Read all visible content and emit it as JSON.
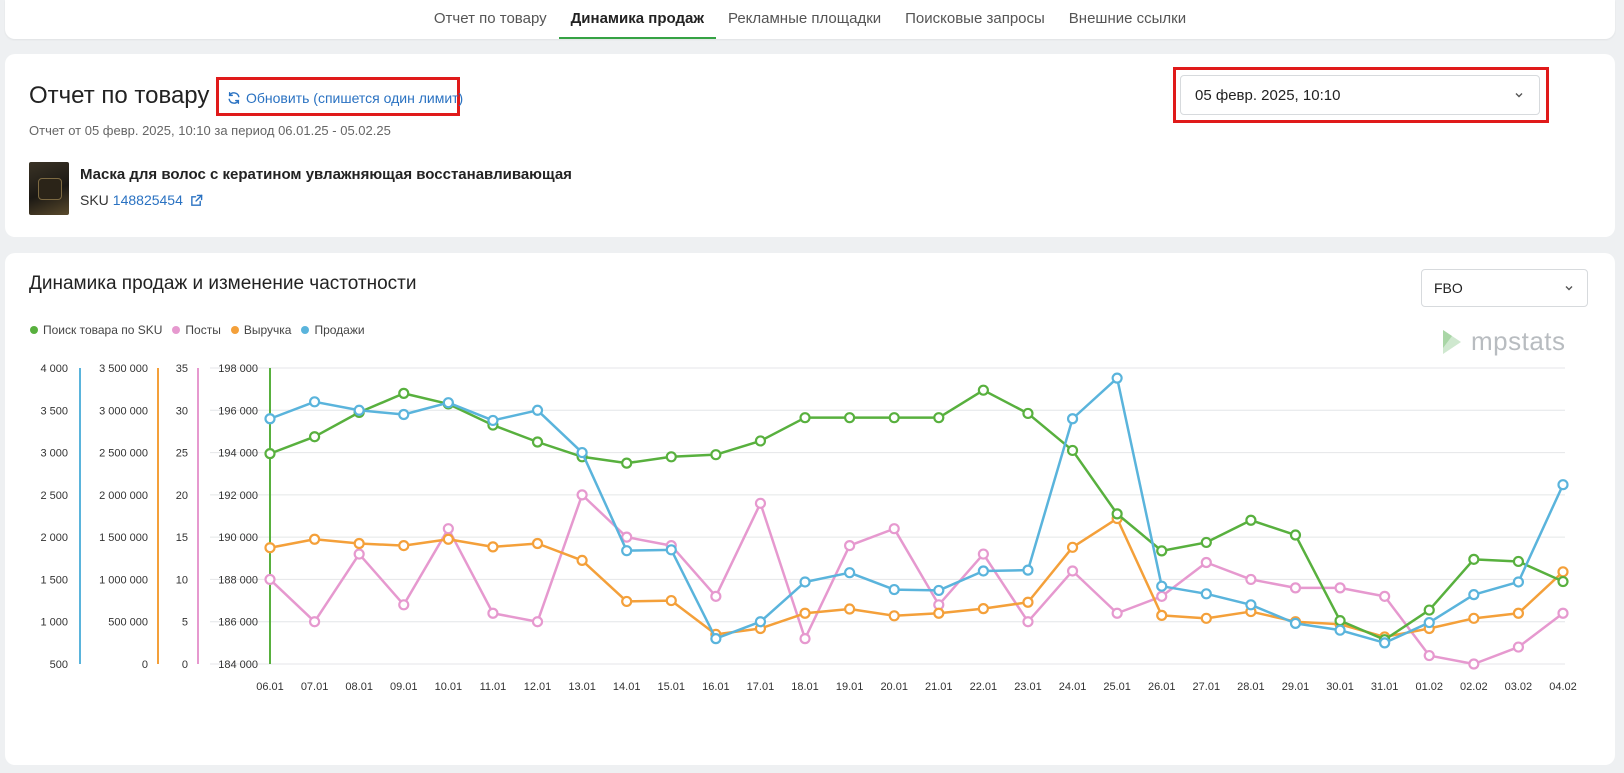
{
  "tabs": [
    {
      "label": "Отчет по товару",
      "active": false
    },
    {
      "label": "Динамика продаж",
      "active": true
    },
    {
      "label": "Рекламные площадки",
      "active": false
    },
    {
      "label": "Поисковые запросы",
      "active": false
    },
    {
      "label": "Внешние ссылки",
      "active": false
    }
  ],
  "report": {
    "title": "Отчет по товару",
    "refresh_label": "Обновить (спишется один лимит)",
    "subtitle": "Отчет от 05 февр. 2025, 10:10 за период 06.01.25 - 05.02.25",
    "product_name": "Маска для волос с кератином увлажняющая восстанавливающая",
    "sku_label": "SKU",
    "sku_value": "148825454",
    "date_select": "05 февр. 2025, 10:10"
  },
  "chart_section": {
    "title": "Динамика продаж и изменение частотности",
    "select_value": "FBO",
    "logo_text": "mpstats"
  },
  "chart_data": {
    "type": "line",
    "categories": [
      "06.01",
      "07.01",
      "08.01",
      "09.01",
      "10.01",
      "11.01",
      "12.01",
      "13.01",
      "14.01",
      "15.01",
      "16.01",
      "17.01",
      "18.01",
      "19.01",
      "20.01",
      "21.01",
      "22.01",
      "23.01",
      "24.01",
      "25.01",
      "26.01",
      "27.01",
      "28.01",
      "29.01",
      "30.01",
      "31.01",
      "01.02",
      "02.02",
      "03.02",
      "04.02"
    ],
    "axes": [
      {
        "id": "sales",
        "color": "#5ab4dc",
        "min": 500,
        "max": 4000,
        "ticks": [
          "500",
          "1 000",
          "1 500",
          "2 000",
          "2 500",
          "3 000",
          "3 500",
          "4 000"
        ]
      },
      {
        "id": "revenue",
        "color": "#f4a03a",
        "min": 0,
        "max": 3500000,
        "ticks": [
          "0",
          "500 000",
          "1 000 000",
          "1 500 000",
          "2 000 000",
          "2 500 000",
          "3 000 000",
          "3 500 000"
        ]
      },
      {
        "id": "posts",
        "color": "#e699cf",
        "min": 0,
        "max": 35,
        "ticks": [
          "0",
          "5",
          "10",
          "15",
          "20",
          "25",
          "30",
          "35"
        ]
      },
      {
        "id": "search",
        "color": "#58b03e",
        "min": 184000,
        "max": 198000,
        "ticks": [
          "184 000",
          "186 000",
          "188 000",
          "190 000",
          "192 000",
          "194 000",
          "196 000",
          "198 000"
        ]
      }
    ],
    "grid": true,
    "legend_position": "top-left",
    "series": [
      {
        "name": "Поиск товара по SKU",
        "axis": "search",
        "color": "#58b03e",
        "values": [
          193950,
          194750,
          195900,
          196800,
          196300,
          195300,
          194500,
          193800,
          193500,
          193800,
          193900,
          194550,
          195650,
          195650,
          195650,
          195650,
          196950,
          195850,
          194100,
          191100,
          189350,
          189750,
          190800,
          190100,
          186050,
          185150,
          186550,
          188950,
          188850,
          187900
        ]
      },
      {
        "name": "Посты",
        "axis": "posts",
        "color": "#e699cf",
        "values": [
          10,
          5,
          13,
          7,
          16,
          6,
          5,
          20,
          15,
          14,
          8,
          19,
          3,
          14,
          16,
          7,
          13,
          5,
          11,
          6,
          8,
          12,
          10,
          9,
          9,
          8,
          1,
          0,
          2,
          6
        ]
      },
      {
        "name": "Выручка",
        "axis": "revenue",
        "color": "#f4a03a",
        "values": [
          1375000,
          1475000,
          1425000,
          1400000,
          1475000,
          1385000,
          1425000,
          1225000,
          740000,
          750000,
          350000,
          420000,
          600000,
          650000,
          570000,
          600000,
          655000,
          730000,
          1380000,
          1720000,
          575000,
          540000,
          620000,
          500000,
          470000,
          320000,
          420000,
          540000,
          600000,
          1090000
        ]
      },
      {
        "name": "Продажи",
        "axis": "sales",
        "color": "#5ab4dc",
        "values": [
          3400,
          3600,
          3500,
          3450,
          3590,
          3380,
          3500,
          3000,
          1840,
          1850,
          800,
          1000,
          1470,
          1580,
          1380,
          1370,
          1600,
          1610,
          3400,
          3880,
          1420,
          1330,
          1200,
          980,
          900,
          750,
          990,
          1320,
          1470,
          2620
        ]
      }
    ]
  }
}
